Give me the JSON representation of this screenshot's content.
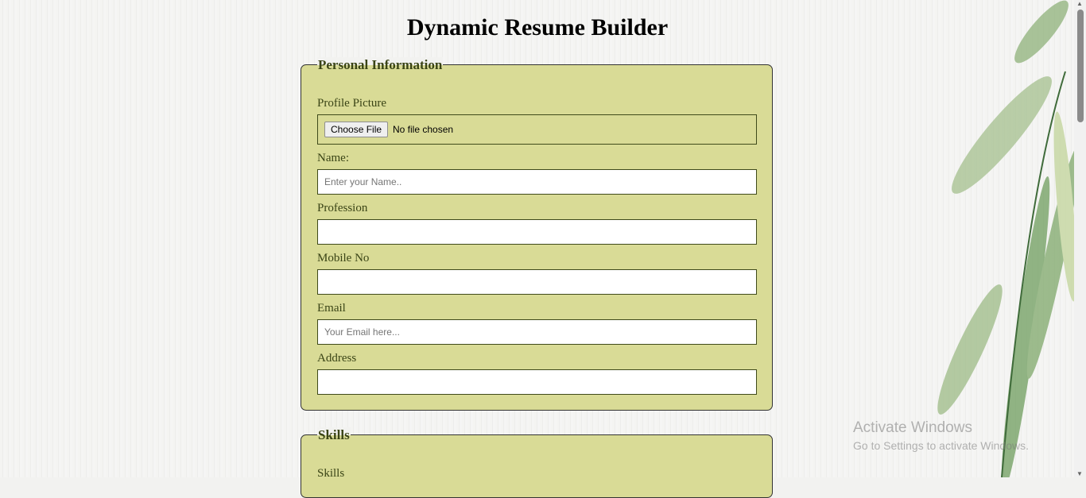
{
  "page_title": "Dynamic Resume Builder",
  "personal": {
    "legend": "Personal Information",
    "profile_label": "Profile Picture",
    "file_button": "Choose File",
    "file_status": "No file chosen",
    "name_label": "Name:",
    "name_placeholder": "Enter your Name..",
    "profession_label": "Profession",
    "mobile_label": "Mobile No",
    "email_label": "Email",
    "email_placeholder": "Your Email here...",
    "address_label": "Address"
  },
  "skills": {
    "legend": "Skills",
    "skills_label": "Skills"
  },
  "watermark": {
    "title": "Activate Windows",
    "subtitle": "Go to Settings to activate Windows."
  },
  "colors": {
    "panel": "#d9db96",
    "label": "#3a4416"
  }
}
